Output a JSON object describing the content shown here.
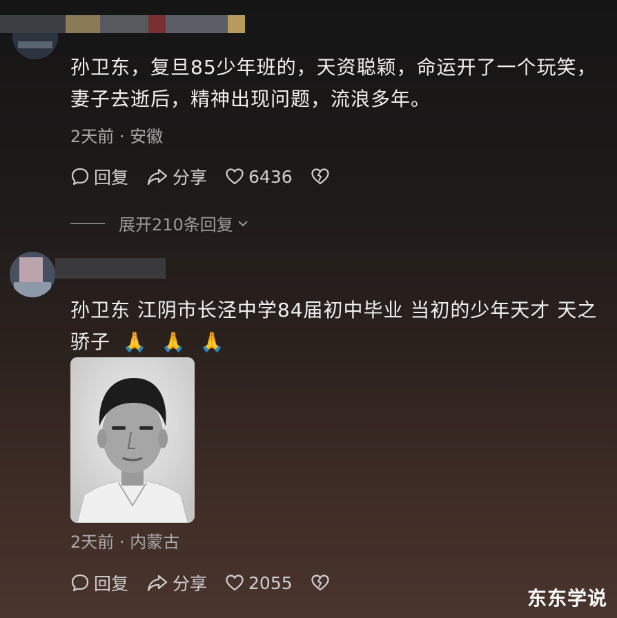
{
  "comments": [
    {
      "text_line1": "孙卫东，复旦85少年班的，天资聪颖，命运开了一个玩笑，",
      "text_line2": "妻子去逝后，精神出现问题，流浪多年。",
      "meta": "2天前 · 安徽",
      "reply_label": "回复",
      "share_label": "分享",
      "likes": "6436",
      "expand_label": "展开210条回复"
    },
    {
      "text_line1": "孙卫东 江阴市长泾中学84届初中毕业 当初的少年天才 天之",
      "text_line2": "骄子",
      "emojis": [
        "🙏",
        "🙏",
        "🙏"
      ],
      "meta": "2天前 · 内蒙古",
      "reply_label": "回复",
      "share_label": "分享",
      "likes": "2055"
    }
  ],
  "watermark": "东东学说",
  "icons": {
    "reply": "speech-bubble-icon",
    "share": "share-arrow-icon",
    "like": "heart-outline-icon",
    "dislike": "broken-heart-icon",
    "expand": "chevron-down-icon"
  }
}
